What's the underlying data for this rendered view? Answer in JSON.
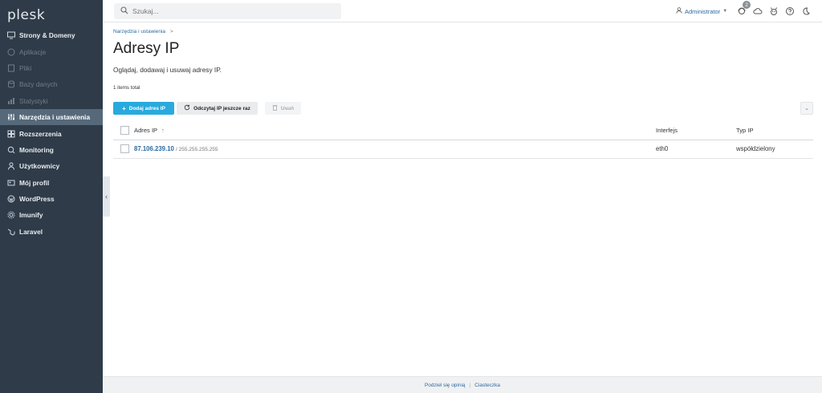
{
  "sidebar": {
    "logo": "plesk",
    "items": [
      {
        "label": "Strony & Domeny",
        "icon": "monitor-icon",
        "state": "normal"
      },
      {
        "label": "Aplikacje",
        "icon": "apps-icon",
        "state": "disabled"
      },
      {
        "label": "Pliki",
        "icon": "file-icon",
        "state": "disabled"
      },
      {
        "label": "Bazy danych",
        "icon": "database-icon",
        "state": "disabled"
      },
      {
        "label": "Statystyki",
        "icon": "stats-icon",
        "state": "disabled"
      },
      {
        "label": "Narzędzia i ustawienia",
        "icon": "sliders-icon",
        "state": "active"
      },
      {
        "label": "Rozszerzenia",
        "icon": "extensions-icon",
        "state": "normal"
      },
      {
        "label": "Monitoring",
        "icon": "monitoring-icon",
        "state": "normal"
      },
      {
        "label": "Użytkownicy",
        "icon": "user-icon",
        "state": "normal"
      },
      {
        "label": "Mój profil",
        "icon": "profile-icon",
        "state": "normal"
      },
      {
        "label": "WordPress",
        "icon": "wordpress-icon",
        "state": "normal"
      },
      {
        "label": "Imunify",
        "icon": "gear-icon",
        "state": "normal"
      },
      {
        "label": "Laravel",
        "icon": "laravel-icon",
        "state": "normal"
      }
    ]
  },
  "topbar": {
    "search_placeholder": "Szukaj...",
    "user": "Administrator",
    "notifications_count": "2"
  },
  "main": {
    "breadcrumb": "Narzędzia i ustawienia",
    "breadcrumb_sep": ">",
    "title": "Adresy IP",
    "description": "Oglądaj, dodawaj i usuwaj adresy IP.",
    "total": "1 items total",
    "add_button": "Dodaj adres IP",
    "reread_button": "Odczytaj IP jeszcze raz",
    "delete_button": "Usuń",
    "table": {
      "headers": [
        "Adres IP",
        "Interfejs",
        "Typ IP"
      ],
      "rows": [
        {
          "ip": "87.106.239.10",
          "mask": "/ 255.255.255.255",
          "interface": "eth0",
          "type": "współdzielony"
        }
      ]
    }
  },
  "footer": {
    "feedback": "Podziel się opinią",
    "cookies": "Ciasteczka"
  },
  "colors": {
    "sidebar_bg": "#2f3b48",
    "sidebar_active": "#56697b",
    "accent": "#28aade",
    "link": "#2c6aa0"
  }
}
